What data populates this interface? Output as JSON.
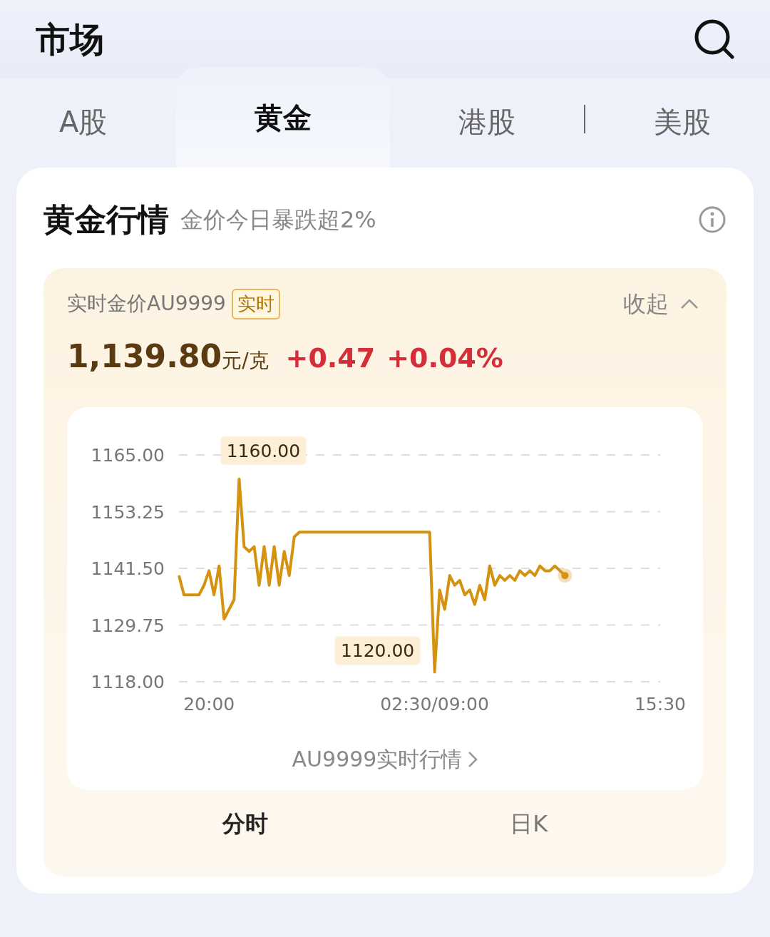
{
  "header": {
    "title": "市场"
  },
  "tabs": [
    {
      "label": "A股",
      "selected": false
    },
    {
      "label": "黄金",
      "selected": true
    },
    {
      "label": "港股",
      "selected": false
    },
    {
      "label": "美股",
      "selected": false
    }
  ],
  "card": {
    "title": "黄金行情",
    "subtitle": "金价今日暴跌超2%",
    "quote": {
      "name": "实时金价AU9999",
      "badge": "实时",
      "collapse": "收起",
      "price": "1,139.80",
      "unit": "元/克",
      "change": "+0.47",
      "percent": "+0.04%",
      "chart_data": {
        "type": "line",
        "categories": [
          null,
          null,
          null,
          null,
          null,
          null,
          "20:00",
          null,
          null,
          null,
          null,
          null,
          null,
          null,
          null,
          null,
          null,
          null,
          null,
          null,
          null,
          null,
          null,
          null,
          null,
          null,
          null,
          null,
          null,
          null,
          null,
          null,
          null,
          null,
          null,
          null,
          null,
          null,
          null,
          null,
          null,
          null,
          null,
          null,
          null,
          null,
          null,
          null,
          null,
          null,
          null,
          "02:30/09:00",
          null,
          null,
          null,
          null,
          null,
          null,
          null,
          null,
          null,
          null,
          null,
          null,
          null,
          null,
          null,
          null,
          null,
          null,
          null,
          null,
          null,
          null,
          null,
          null,
          null,
          null,
          null,
          null,
          null,
          null,
          null,
          null,
          null,
          null,
          null,
          null,
          null,
          null,
          null,
          null,
          null,
          null,
          null,
          null,
          "15:30"
        ],
        "series": [
          {
            "color": "#d4920f",
            "values": [
              1140,
              1136,
              1136,
              1136,
              1136,
              1138,
              1141,
              1136,
              1142,
              1131,
              1133,
              1135,
              1160,
              1146,
              1145,
              1146,
              1138,
              1146,
              1138,
              1146,
              1138,
              1145,
              1140,
              1148,
              1149,
              1149,
              1149,
              1149,
              1149,
              1149,
              1149,
              1149,
              1149,
              1149,
              1149,
              1149,
              1149,
              1149,
              1149,
              1149,
              1149,
              1149,
              1149,
              1149,
              1149,
              1149,
              1149,
              1149,
              1149,
              1149,
              1149,
              1120,
              1137,
              1133,
              1140,
              1138,
              1139,
              1136,
              1137,
              1134,
              1138,
              1135,
              1142,
              1138,
              1140,
              1139,
              1140,
              1139,
              1141,
              1140,
              1141,
              1140,
              1142,
              1141,
              1141,
              1142,
              1141,
              1140,
              null,
              null,
              null,
              null,
              null,
              null,
              null,
              null,
              null,
              null,
              null,
              null,
              null,
              null,
              null,
              null,
              null,
              null,
              null
            ]
          }
        ],
        "grid": true,
        "ylim": [
          1118,
          1165
        ],
        "yticks": [
          {
            "value": 1165,
            "label": "1165.00"
          },
          {
            "value": 1153.25,
            "label": "1153.25"
          },
          {
            "value": 1141.5,
            "label": "1141.50"
          },
          {
            "value": 1129.75,
            "label": "1129.75"
          },
          {
            "value": 1118,
            "label": "1118.00"
          }
        ],
        "annotations": [
          "1160.00",
          "1120.00"
        ]
      },
      "link": "AU9999实时行情",
      "periods": [
        {
          "label": "分时",
          "selected": true
        },
        {
          "label": "日K",
          "selected": false
        }
      ]
    }
  }
}
